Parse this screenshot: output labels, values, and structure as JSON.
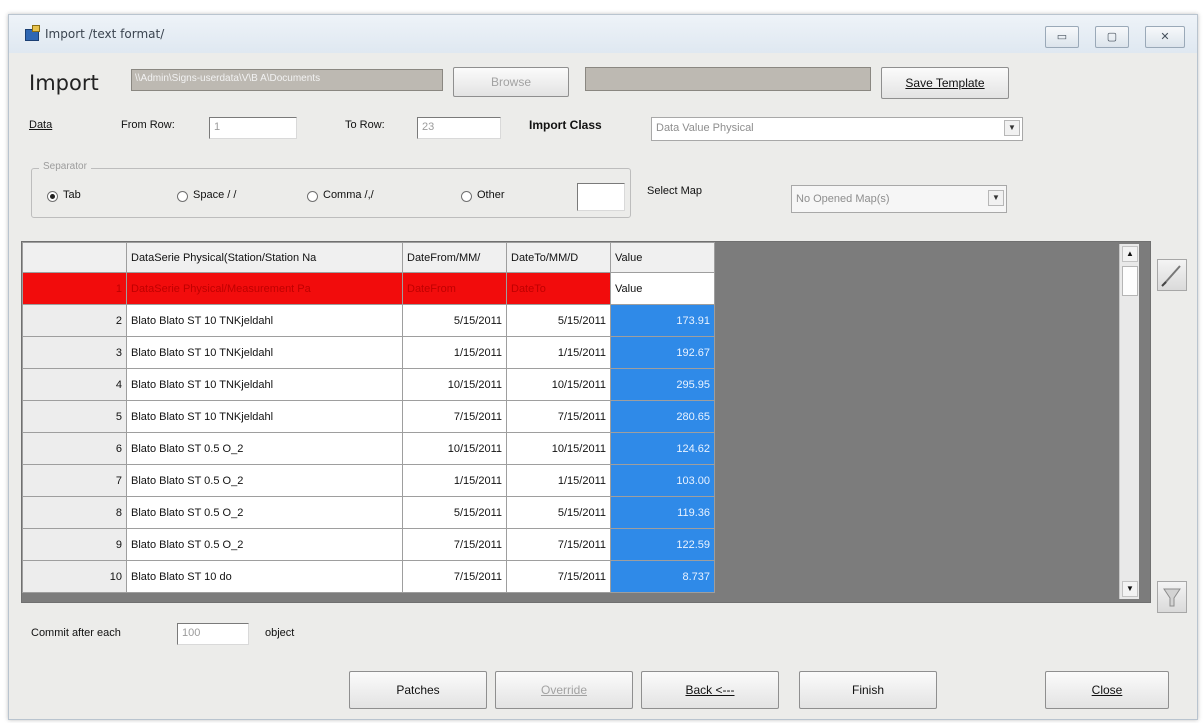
{
  "window": {
    "title": "Import /text format/",
    "controls": {
      "minimize": "▭",
      "maximize": "▢",
      "close": "✕"
    }
  },
  "import_bar": {
    "label": "Import",
    "path_value": "\\\\Admin\\Signs-userdata\\V\\B A\\Documents",
    "browse_label": "Browse",
    "template_path_value": "",
    "save_template_label": "Save Template"
  },
  "data_row": {
    "data_label": "Data",
    "from_row_label": "From Row:",
    "from_row_value": "1",
    "to_row_label": "To Row:",
    "to_row_value": "23",
    "import_class_label": "Import Class",
    "import_class_value": "Data Value Physical"
  },
  "separator": {
    "legend": "Separator",
    "options": {
      "tab": "Tab",
      "space": "Space / /",
      "comma": "Comma /,/",
      "other": "Other"
    },
    "selected": "tab",
    "other_value": "",
    "select_map_label": "Select Map",
    "select_map_value": "No Opened Map(s)"
  },
  "grid": {
    "columns": [
      "",
      "DataSerie Physical(Station/Station Na",
      "DateFrom/MM/",
      "DateTo/MM/D",
      "Value"
    ],
    "mapping_row": {
      "rownum": "1",
      "series": "DataSerie Physical/Measurement Pa",
      "date_from": "DateFrom",
      "date_to": "DateTo",
      "value": "Value"
    },
    "rows": [
      {
        "rownum": "2",
        "series": "Blato Blato ST 10 TNKjeldahl",
        "date_from": "5/15/2011",
        "date_to": "5/15/2011",
        "value": "173.91"
      },
      {
        "rownum": "3",
        "series": "Blato Blato ST 10 TNKjeldahl",
        "date_from": "1/15/2011",
        "date_to": "1/15/2011",
        "value": "192.67"
      },
      {
        "rownum": "4",
        "series": "Blato Blato ST 10 TNKjeldahl",
        "date_from": "10/15/2011",
        "date_to": "10/15/2011",
        "value": "295.95"
      },
      {
        "rownum": "5",
        "series": "Blato Blato ST 10 TNKjeldahl",
        "date_from": "7/15/2011",
        "date_to": "7/15/2011",
        "value": "280.65"
      },
      {
        "rownum": "6",
        "series": "Blato Blato ST 0.5 O_2",
        "date_from": "10/15/2011",
        "date_to": "10/15/2011",
        "value": "124.62"
      },
      {
        "rownum": "7",
        "series": "Blato Blato ST 0.5 O_2",
        "date_from": "1/15/2011",
        "date_to": "1/15/2011",
        "value": "103.00"
      },
      {
        "rownum": "8",
        "series": "Blato Blato ST 0.5 O_2",
        "date_from": "5/15/2011",
        "date_to": "5/15/2011",
        "value": "119.36"
      },
      {
        "rownum": "9",
        "series": "Blato Blato ST 0.5 O_2",
        "date_from": "7/15/2011",
        "date_to": "7/15/2011",
        "value": "122.59"
      },
      {
        "rownum": "10",
        "series": "Blato Blato ST 10 do",
        "date_from": "7/15/2011",
        "date_to": "7/15/2011",
        "value": "8.737"
      }
    ]
  },
  "commit": {
    "label": "Commit after each",
    "value": "100",
    "suffix": "object"
  },
  "buttons": {
    "patches": "Patches",
    "override": "Override",
    "back": "Back <---",
    "finish": "Finish",
    "close": "Close"
  }
}
